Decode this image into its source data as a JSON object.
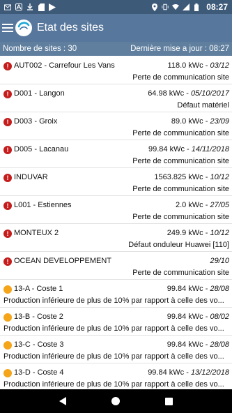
{
  "statusbar": {
    "time": "08:27",
    "icons_left": [
      "gmail-icon",
      "a-box-icon",
      "download-icon",
      "sd-card-icon",
      "play-store-icon"
    ],
    "icons_right": [
      "location-icon",
      "vibrate-icon",
      "wifi-icon",
      "signal-icon",
      "battery-icon"
    ]
  },
  "appbar": {
    "title": "Etat des sites"
  },
  "summary": {
    "count_label": "Nombre de sites : 30",
    "update_label": "Dernière mise a jour : 08:27"
  },
  "colors": {
    "error": "#c51c1c",
    "warning": "#f5a519",
    "appbar": "#58779c",
    "statusbar": "#3e5a79",
    "summary": "#607f9f"
  },
  "sites": [
    {
      "status": "error",
      "name": "AUT002 - Carrefour Les Vans",
      "power": "118.0 kWc",
      "date": "03/12",
      "message": "Perte de communication site"
    },
    {
      "status": "error",
      "name": "D001 - Langon",
      "power": "64.98 kWc",
      "date": "05/10/2017",
      "message": "Défaut matériel"
    },
    {
      "status": "error",
      "name": "D003 - Groix",
      "power": "89.0 kWc",
      "date": "23/09",
      "message": "Perte de communication site"
    },
    {
      "status": "error",
      "name": "D005 - Lacanau",
      "power": "99.84 kWc",
      "date": "14/11/2018",
      "message": "Perte de communication site"
    },
    {
      "status": "error",
      "name": "INDUVAR",
      "power": "1563.825 kWc",
      "date": "10/12",
      "message": "Perte de communication site"
    },
    {
      "status": "error",
      "name": "L001 - Estiennes",
      "power": "2.0 kWc",
      "date": "27/05",
      "message": "Perte de communication site"
    },
    {
      "status": "error",
      "name": "MONTEUX 2",
      "power": "249.9 kWc",
      "date": "10/12",
      "message": "Défaut onduleur Huawei [110]"
    },
    {
      "status": "error",
      "name": "OCEAN DEVELOPPEMENT",
      "power": "",
      "date": "29/10",
      "message": "Perte de communication site"
    },
    {
      "status": "warning",
      "name": "13-A - Coste 1",
      "power": "99.84 kWc",
      "date": "28/08",
      "message": "Production inférieure de plus de 10% par rapport à celle des vo..."
    },
    {
      "status": "warning",
      "name": "13-B - Coste 2",
      "power": "99.84 kWc",
      "date": "08/02",
      "message": "Production inférieure de plus de 10% par rapport à celle des vo..."
    },
    {
      "status": "warning",
      "name": "13-C - Coste 3",
      "power": "99.84 kWc",
      "date": "28/08",
      "message": "Production inférieure de plus de 10% par rapport à celle des vo..."
    },
    {
      "status": "warning",
      "name": "13-D - Coste 4",
      "power": "99.84 kWc",
      "date": "13/12/2018",
      "message": "Production inférieure de plus de 10% par rapport à celle des vo..."
    }
  ],
  "navbar": {
    "buttons": [
      "back-icon",
      "home-icon",
      "recents-icon"
    ]
  }
}
